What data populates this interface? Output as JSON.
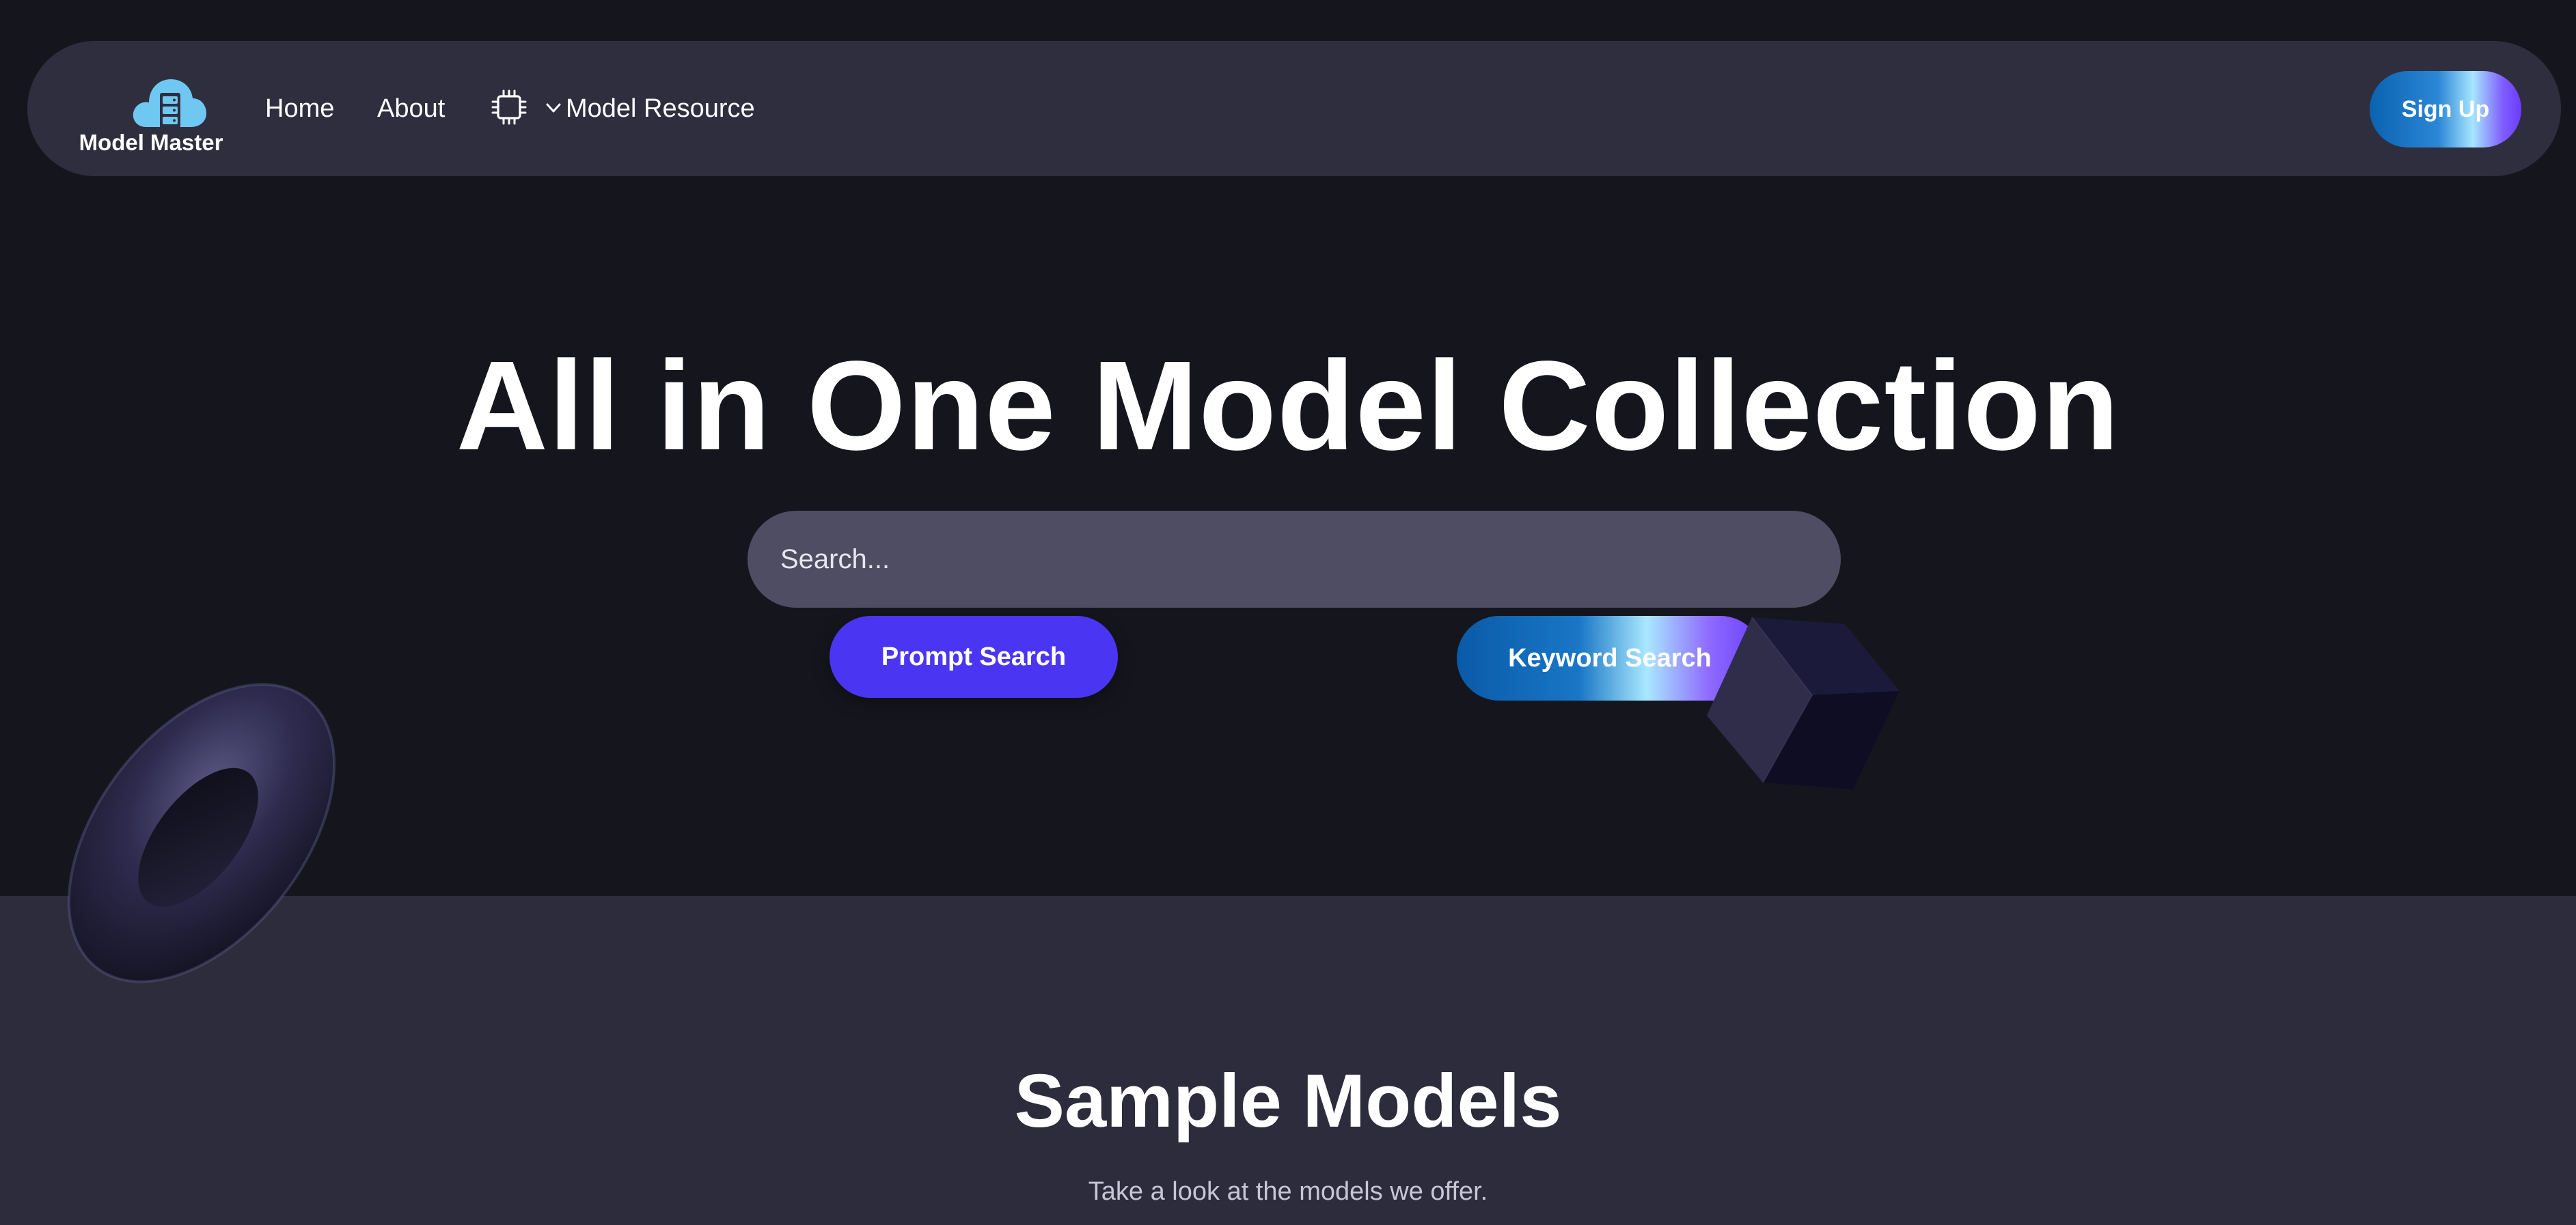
{
  "navbar": {
    "brand": "Model Master",
    "links": {
      "home": "Home",
      "about": "About",
      "model_resource": "Model Resource"
    },
    "signup_label": "Sign Up",
    "icons": {
      "logo": "cloud-server-icon",
      "resource": "cpu-chip-icon",
      "dropdown": "chevron-down-icon"
    }
  },
  "hero": {
    "title": "All in One Model Collection",
    "search": {
      "value": "",
      "placeholder": "Search..."
    },
    "prompt_search_label": "Prompt Search",
    "keyword_search_label": "Keyword Search"
  },
  "samples": {
    "title": "Sample Models",
    "subtitle": "Take a look at the models we offer."
  },
  "colors": {
    "background": "#15161d",
    "navbar": "#2f2e3f",
    "search_field": "#4e4d63",
    "prompt_button": "#4a36f2",
    "section": "#2d2c3c",
    "logo_cloud": "#6fc8f2"
  }
}
